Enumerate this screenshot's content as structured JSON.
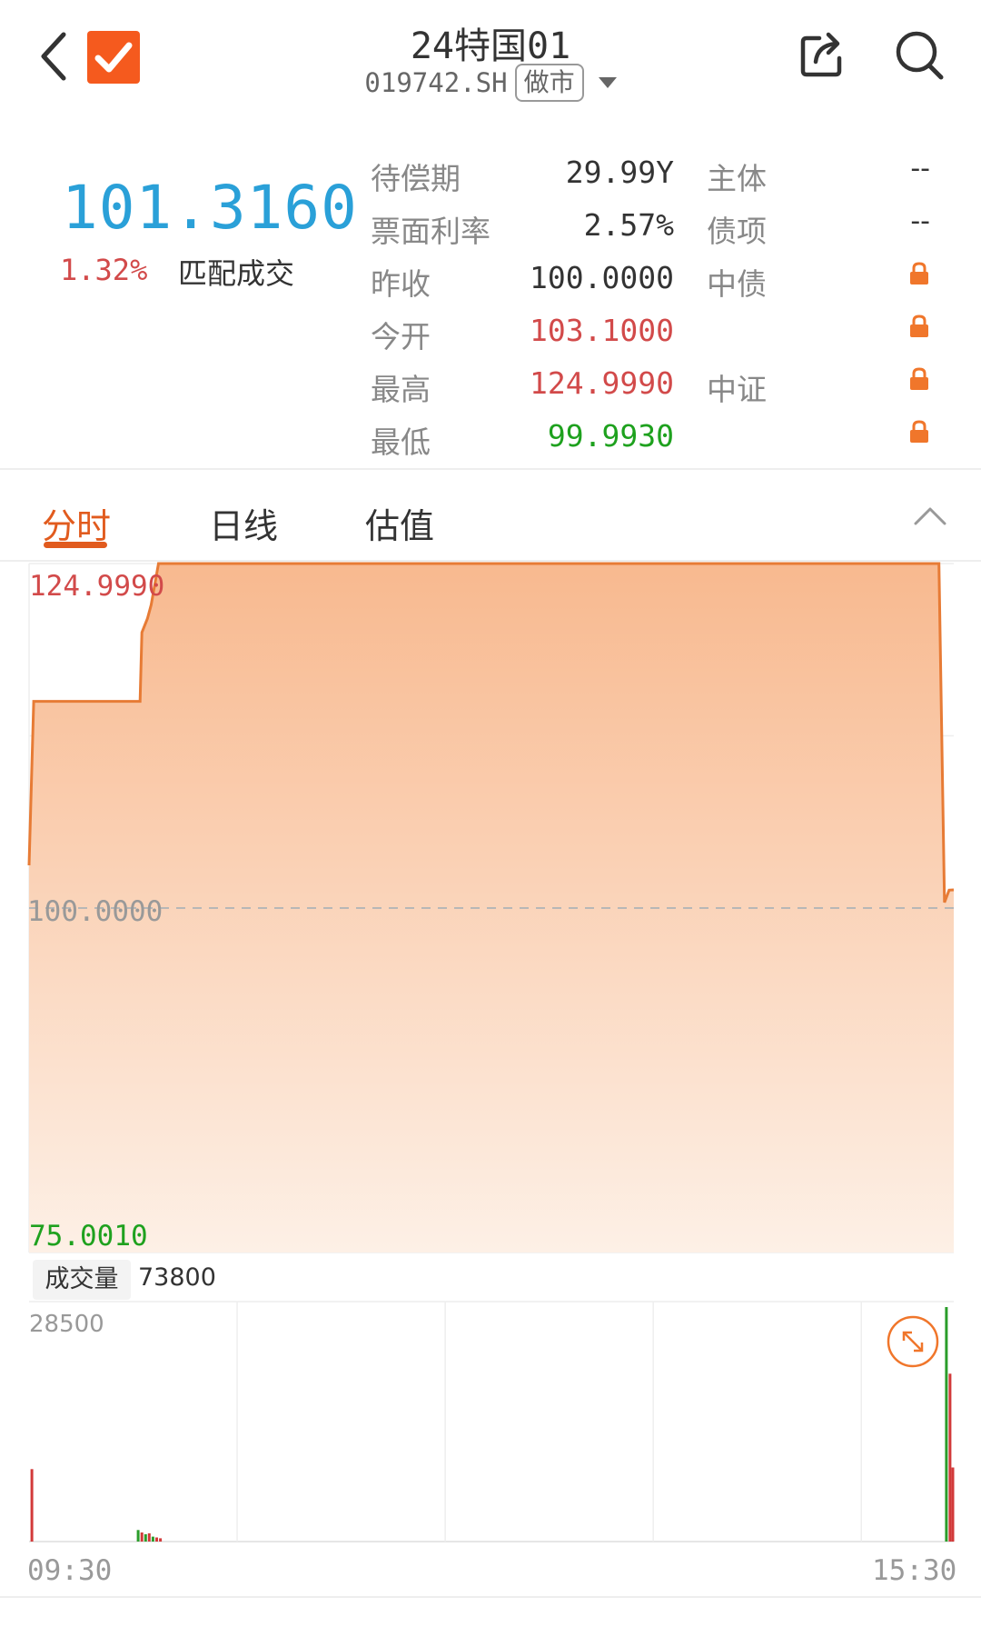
{
  "header": {
    "title": "24特国01",
    "code": "019742.SH",
    "market_tag": "做市"
  },
  "quote": {
    "price": "101.3160",
    "change_pct": "1.32%",
    "trade_type": "匹配成交",
    "fields": [
      {
        "label": "待偿期",
        "value": "29.99Y",
        "tone": "normal"
      },
      {
        "label": "票面利率",
        "value": "2.57%",
        "tone": "normal"
      },
      {
        "label": "昨收",
        "value": "100.0000",
        "tone": "normal"
      },
      {
        "label": "今开",
        "value": "103.1000",
        "tone": "red"
      },
      {
        "label": "最高",
        "value": "124.9990",
        "tone": "red"
      },
      {
        "label": "最低",
        "value": "99.9930",
        "tone": "green"
      }
    ],
    "ratings": [
      {
        "label": "主体",
        "value": "--",
        "locked": false
      },
      {
        "label": "债项",
        "value": "--",
        "locked": false
      },
      {
        "label": "中债",
        "value": "",
        "locked": true
      },
      {
        "label": "",
        "value": "",
        "locked": true
      },
      {
        "label": "中证",
        "value": "",
        "locked": true
      },
      {
        "label": "",
        "value": "",
        "locked": true
      }
    ]
  },
  "tabs": [
    {
      "label": "分时",
      "active": true
    },
    {
      "label": "日线",
      "active": false
    },
    {
      "label": "估值",
      "active": false
    }
  ],
  "chart_data": {
    "type": "line",
    "y_top_label": "124.9990",
    "y_mid_label": "100.0000",
    "y_bottom_label": "75.0010",
    "ylim": [
      75.001,
      124.999
    ],
    "prev_close": 100.0,
    "x_start": "09:30",
    "x_end": "15:30",
    "series_price": {
      "points": [
        [
          0,
          103.1
        ],
        [
          0.5,
          115.0
        ],
        [
          12.0,
          115.0
        ],
        [
          12.2,
          120.0
        ],
        [
          12.8,
          121.0
        ],
        [
          13.2,
          122.0
        ],
        [
          14.0,
          124.999
        ],
        [
          98.4,
          124.999
        ],
        [
          99.0,
          100.4
        ],
        [
          99.5,
          101.3
        ],
        [
          100,
          101.316
        ]
      ]
    },
    "volume": {
      "label": "成交量",
      "value": "73800",
      "max_label": "28500",
      "max": 28500,
      "bars": [
        {
          "t": 0.3,
          "v": 8800,
          "dir": "up"
        },
        {
          "t": 11.8,
          "v": 1400,
          "dir": "down"
        },
        {
          "t": 12.2,
          "v": 1100,
          "dir": "up"
        },
        {
          "t": 12.6,
          "v": 900,
          "dir": "down"
        },
        {
          "t": 13.0,
          "v": 1000,
          "dir": "up"
        },
        {
          "t": 13.4,
          "v": 600,
          "dir": "down"
        },
        {
          "t": 13.8,
          "v": 500,
          "dir": "up"
        },
        {
          "t": 14.2,
          "v": 400,
          "dir": "up"
        },
        {
          "t": 99.2,
          "v": 28500,
          "dir": "down"
        },
        {
          "t": 99.6,
          "v": 20400,
          "dir": "up"
        },
        {
          "t": 99.9,
          "v": 9000,
          "dir": "up"
        }
      ]
    },
    "colors": {
      "line": "#e77b35",
      "fill_top": "#f8b98f",
      "fill_bottom": "#fdf0e6",
      "up": "#d23a3a",
      "down": "#2a9d2a",
      "grid": "#eeeeee",
      "dash": "#b7b7b7"
    }
  }
}
